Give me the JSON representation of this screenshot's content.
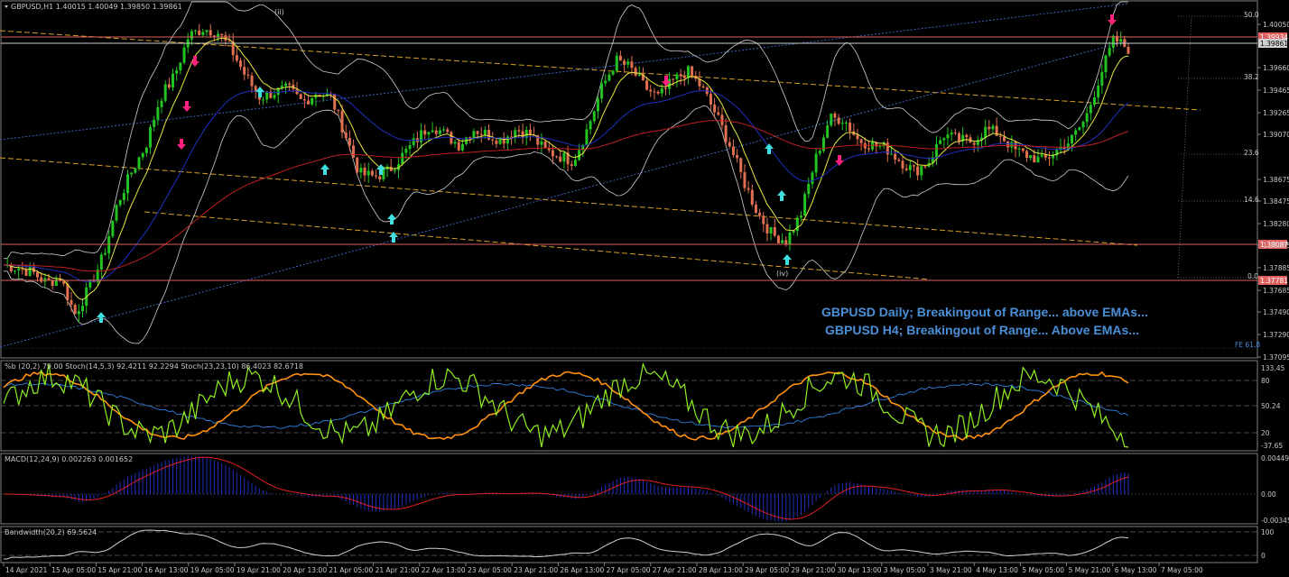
{
  "header": {
    "symbol_line": "GBPUSD,H1  1.40015 1.40049 1.39850 1.39861"
  },
  "indicators": {
    "stoch_label": "%b (20,2) 79.00   Stoch(14,5,3) 92.4211 92.2294   Stoch(23,23,10) 86.4023 82.6718",
    "macd_label": "MACD(12,24,9) 0.002263 0.001652",
    "bandwidth_label": "Bandwidth(20,2) 69.5624"
  },
  "annotations": {
    "line1": "GBPUSD Daily; Breakingout of Range... above EMAs...",
    "line2": "GBPUSD H4; Breakingout of Range... Above EMAs...",
    "wave_ii": "(ii)",
    "wave_iv": "(iv)",
    "fib_50": "50.0",
    "fib_382": "38.2",
    "fib_236": "23.6",
    "fib_146": "14.6",
    "fib_0": "0.0",
    "fe_618": "FE 61.8"
  },
  "colors": {
    "background": "#000000",
    "bull_candle": "#22c322",
    "bear_candle": "#e07050",
    "ema_fast": "#e8e840",
    "ema_mid": "#2030c0",
    "ema_slow": "#c02020",
    "bollinger": "#d0d0d0",
    "channel": "#d8a020",
    "trend_blue": "#4060c0",
    "level_line": "#e06060",
    "buy_arrow": "#40e0e0",
    "sell_arrow": "#ff2080",
    "stoch_green": "#90f020",
    "stoch_orange": "#ff9010",
    "stoch_blue": "#3080e0",
    "macd_hist": "#2030c0",
    "macd_signal": "#e02020",
    "note_text": "#4a90d9"
  },
  "chart_data": [
    {
      "type": "line",
      "name": "price",
      "price_axis": [
        "1.40050",
        "1.39660",
        "1.39465",
        "1.39265",
        "1.39070",
        "1.38675",
        "1.38475",
        "1.38280",
        "1.38085",
        "1.37885",
        "1.37685",
        "1.37490",
        "1.37290",
        "1.37095"
      ],
      "level_labels": [
        {
          "value": "1.39934",
          "color": "#e06060"
        },
        {
          "value": "1.39861",
          "color": "#d0d0d0"
        },
        {
          "value": "1.38087",
          "color": "#e06060"
        },
        {
          "value": "1.37781",
          "color": "#e06060"
        }
      ],
      "time_axis": [
        "14 Apr 2021",
        "15 Apr 05:00",
        "15 Apr 21:00",
        "16 Apr 13:00",
        "19 Apr 05:00",
        "19 Apr 21:00",
        "20 Apr 13:00",
        "21 Apr 05:00",
        "21 Apr 21:00",
        "22 Apr 13:00",
        "23 Apr 05:00",
        "23 Apr 21:00",
        "26 Apr 13:00",
        "27 Apr 05:00",
        "27 Apr 21:00",
        "28 Apr 13:00",
        "29 Apr 05:00",
        "29 Apr 21:00",
        "30 Apr 13:00",
        "3 May 05:00",
        "3 May 21:00",
        "4 May 13:00",
        "5 May 05:00",
        "5 May 21:00",
        "6 May 13:00",
        "7 May 05:00"
      ],
      "close": [
        1.3782,
        1.3779,
        1.3775,
        1.3765,
        1.377,
        1.3735,
        1.376,
        1.379,
        1.384,
        1.387,
        1.3895,
        1.394,
        1.396,
        1.3998,
        1.4005,
        1.4002,
        1.3985,
        1.396,
        1.394,
        1.3945,
        1.3948,
        1.3935,
        1.3945,
        1.394,
        1.3905,
        1.3868,
        1.3865,
        1.387,
        1.3885,
        1.39,
        1.3915,
        1.3905,
        1.3895,
        1.391,
        1.3905,
        1.39,
        1.391,
        1.3905,
        1.389,
        1.3885,
        1.388,
        1.391,
        1.3948,
        1.3975,
        1.3968,
        1.395,
        1.394,
        1.3955,
        1.3965,
        1.395,
        1.3925,
        1.3895,
        1.386,
        1.383,
        1.381,
        1.3805,
        1.383,
        1.388,
        1.392,
        1.392,
        1.39,
        1.3895,
        1.3892,
        1.388,
        1.387,
        1.388,
        1.3905,
        1.39,
        1.3898,
        1.391,
        1.3905,
        1.389,
        1.3885,
        1.388,
        1.389,
        1.39,
        1.392,
        1.396,
        1.3995,
        1.3986
      ],
      "stoch_axis": [
        "133.45",
        "80",
        "50.24",
        "20",
        "-37.65"
      ],
      "macd_axis": [
        "0.004493",
        "0.00",
        "-0.003456"
      ],
      "bandwidth_axis": [
        "100",
        "0"
      ]
    }
  ]
}
